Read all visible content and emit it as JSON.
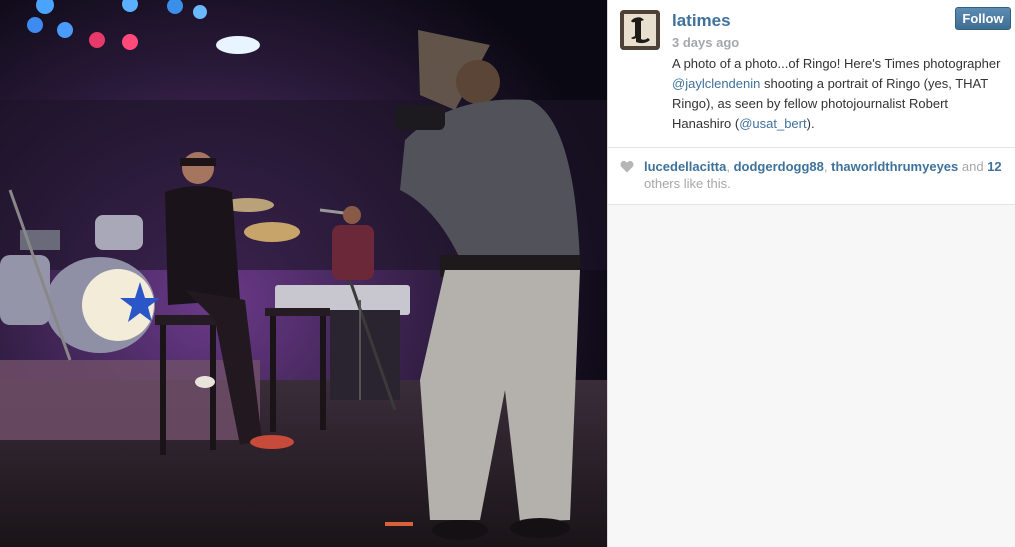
{
  "post": {
    "username": "latimes",
    "time_ago": "3 days ago",
    "follow_label": "Follow",
    "caption": {
      "t1": "A photo of a photo...of Ringo! Here's Times photographer ",
      "mention1": "@jaylclendenin",
      "t2": " shooting a portrait of Ringo (yes, THAT Ringo), as seen by fellow photojournalist Robert Hanashiro (",
      "mention2": "@usat_bert",
      "t3": ")."
    },
    "likes": {
      "user1": "lucedellacitta",
      "sep1": ", ",
      "user2": "dodgerdogg88",
      "sep2": ", ",
      "user3": "thaworldthrumyeyes",
      "t_and": " and ",
      "others_count": "12",
      "t_others": " others like this."
    },
    "icons": {
      "avatar": "latimes-logo-icon",
      "like": "heart-icon"
    },
    "colors": {
      "link": "#3f729b",
      "muted": "#a5a7aa",
      "follow_button": "#4e7ea6"
    }
  }
}
